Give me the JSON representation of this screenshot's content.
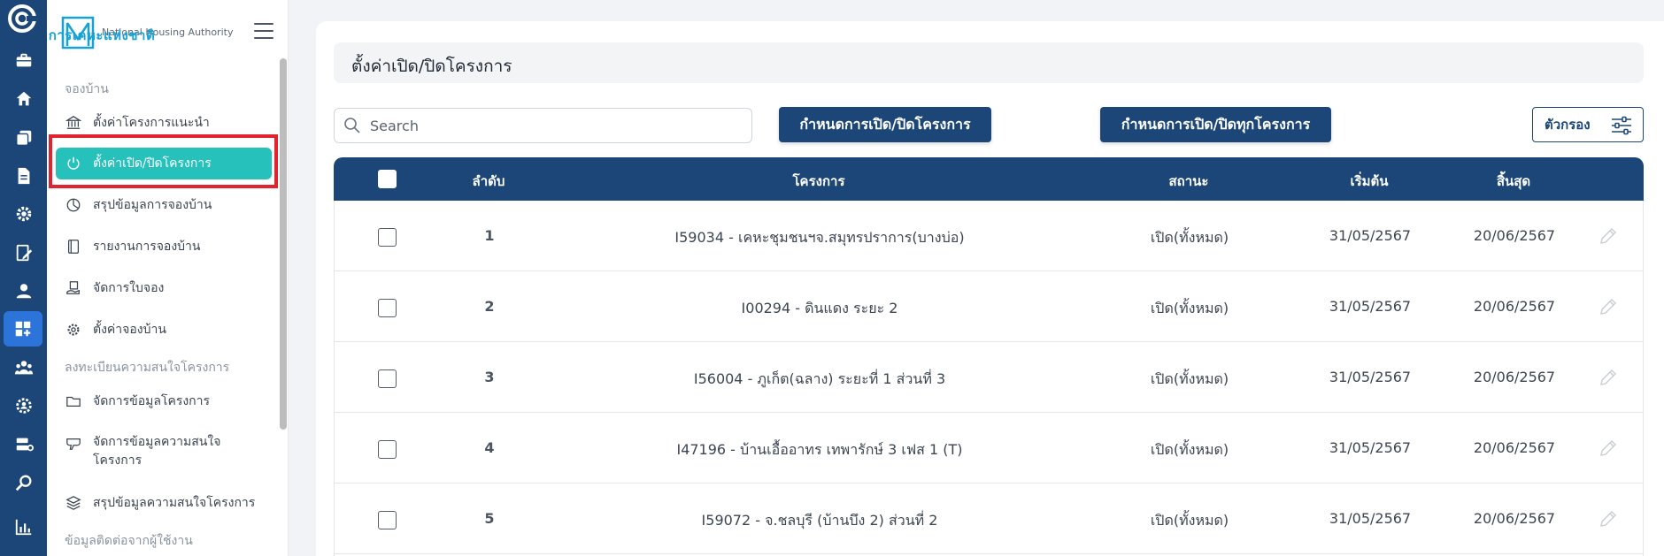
{
  "brand": {
    "name_th": "การเคหะแห่งชาติ",
    "name_en": "National Housing Authority"
  },
  "rail": {
    "items": [
      "briefcase-icon",
      "home-icon",
      "layers-icon",
      "document-icon",
      "settings-gear-icon",
      "form-edit-icon",
      "user-icon",
      "dashboard-add-icon",
      "group-icon",
      "settings-user-icon",
      "server-icon",
      "search-icon",
      "chart-icon"
    ],
    "active_index": 7
  },
  "sidebar": {
    "sections": [
      {
        "label": "จองบ้าน"
      },
      {
        "label": "ลงทะเบียนความสนใจโครงการ"
      },
      {
        "label": "ข้อมูลติดต่อจากผู้ใช้งาน"
      }
    ],
    "items": [
      {
        "label": "ตั้งค่าโครงการแนะนำ",
        "icon": "bank-icon"
      },
      {
        "label": "ตั้งค่าเปิด/ปิดโครงการ",
        "icon": "power-icon",
        "active": true
      },
      {
        "label": "สรุปข้อมูลการจองบ้าน",
        "icon": "pie-chart-icon"
      },
      {
        "label": "รายงานการจองบ้าน",
        "icon": "book-icon"
      },
      {
        "label": "จัดการใบจอง",
        "icon": "hand-document-icon"
      },
      {
        "label": "ตั้งค่าจองบ้าน",
        "icon": "gear-icon"
      },
      {
        "label": "จัดการข้อมูลโครงการ",
        "icon": "folder-icon"
      },
      {
        "label": "จัดการข้อมูลความสนใจโครงการ",
        "icon": "megaphone-icon"
      },
      {
        "label": "สรุปข้อมูลความสนใจโครงการ",
        "icon": "stack-icon"
      }
    ]
  },
  "main": {
    "title": "ตั้งค่าเปิด/ปิดโครงการ",
    "search_placeholder": "Search",
    "btn_set_project": "กำหนดการเปิด/ปิดโครงการ",
    "btn_set_all": "กำหนดการเปิด/ปิดทุกโครงการ",
    "btn_filter": "ตัวกรอง"
  },
  "table": {
    "headers": {
      "index": "ลำดับ",
      "project": "โครงการ",
      "status": "สถานะ",
      "start": "เริ่มต้น",
      "end": "สิ้นสุด"
    },
    "rows": [
      {
        "index": "1",
        "project": "I59034 - เคหะชุมชนฯจ.สมุทรปราการ(บางบ่อ)",
        "status": "เปิด(ทั้งหมด)",
        "start": "31/05/2567",
        "end": "20/06/2567"
      },
      {
        "index": "2",
        "project": "I00294 - ดินแดง ระยะ 2",
        "status": "เปิด(ทั้งหมด)",
        "start": "31/05/2567",
        "end": "20/06/2567"
      },
      {
        "index": "3",
        "project": "I56004 - ภูเก็ต(ฉลาง) ระยะที่ 1 ส่วนที่ 3",
        "status": "เปิด(ทั้งหมด)",
        "start": "31/05/2567",
        "end": "20/06/2567"
      },
      {
        "index": "4",
        "project": "I47196 - บ้านเอื้ออาทร เทพารักษ์ 3 เฟส 1 (T)",
        "status": "เปิด(ทั้งหมด)",
        "start": "31/05/2567",
        "end": "20/06/2567"
      },
      {
        "index": "5",
        "project": "I59072 - จ.ชลบุรี (บ้านบึง 2) ส่วนที่ 2",
        "status": "เปิด(ทั้งหมด)",
        "start": "31/05/2567",
        "end": "20/06/2567"
      }
    ]
  },
  "colors": {
    "rail_bg": "#1b4677",
    "accent_teal": "#26c1bb",
    "primary": "#1b4677",
    "highlight": "#e0232e"
  }
}
